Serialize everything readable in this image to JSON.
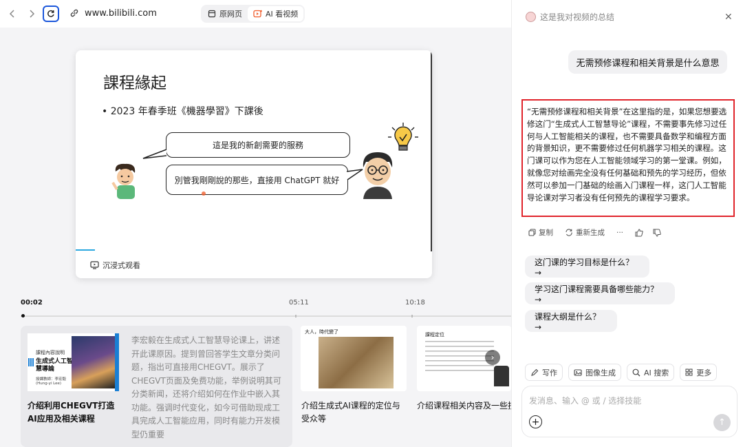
{
  "browser": {
    "url": "www.bilibili.com",
    "tab_original": "原网页",
    "tab_ai": "AI 看视频"
  },
  "slide": {
    "title": "課程緣起",
    "bullet": "• 2023 年春季班《機器學習》下課後",
    "bubble1": "這是我的新創需要的服務",
    "bubble2": "別管我剛剛說的那些，直接用 ChatGPT 就好",
    "immersive": "沉浸式观看"
  },
  "timeline": {
    "current": "00:02",
    "mark1": "05:11",
    "mark2": "10:18"
  },
  "chapters": [
    {
      "title": "介绍利用CHEGVT打造AI应用及相关课程",
      "desc": "李宏毅在生成式人工智慧导论课上，讲述开此课原因。提到曾回答学生文章分类问题，指出可直接用CHEGVT。展示了CHEGVT页面及免费功能，举例说明其可分类新闻，还将介绍如何在作业中嵌入其功能。强调时代变化，如今可借助现成工具完成人工智能应用，同时有能力开发模型仍重要",
      "thumb_label": "課程內容說明",
      "thumb_title": "生成式人工智慧導論",
      "thumb_sub": "授課教師：李宏毅",
      "thumb_sub2": "(Hung-yi Lee)"
    },
    {
      "title": "介绍生成式AI课程的定位与受众等",
      "thumb_label": "大人，時代變了"
    },
    {
      "title": "介绍课程相关内容及一些技术概念",
      "thumb_label": "課程定位"
    }
  ],
  "panel": {
    "header": "这是我对视频的总结",
    "user_message": "无需预修课程和相关背景是什么意思",
    "answer": "“无需预修课程和相关背景”在这里指的是，如果您想要选修这门“生成式人工智慧导论”课程，不需要事先修习过任何与人工智能相关的课程，也不需要具备数学和编程方面的背景知识，更不需要修过任何机器学习相关的课程。这门课可以作为您在人工智能领域学习的第一堂课。例如，就像您对绘画完全没有任何基础和预先的学习经历，但依然可以参加一门基础的绘画入门课程一样，这门人工智能导论课对学习者没有任何预先的课程学习要求。",
    "copy": "复制",
    "regenerate": "重新生成",
    "more_dots": "···",
    "suggestions": [
      "这门课的学习目标是什么？ →",
      "学习这门课程需要具备哪些能力？ →",
      "课程大纲是什么？ →"
    ],
    "tools": [
      "写作",
      "图像生成",
      "AI 搜索",
      "更多"
    ],
    "input_placeholder": "发消息、输入 @ 或 / 选择技能"
  }
}
